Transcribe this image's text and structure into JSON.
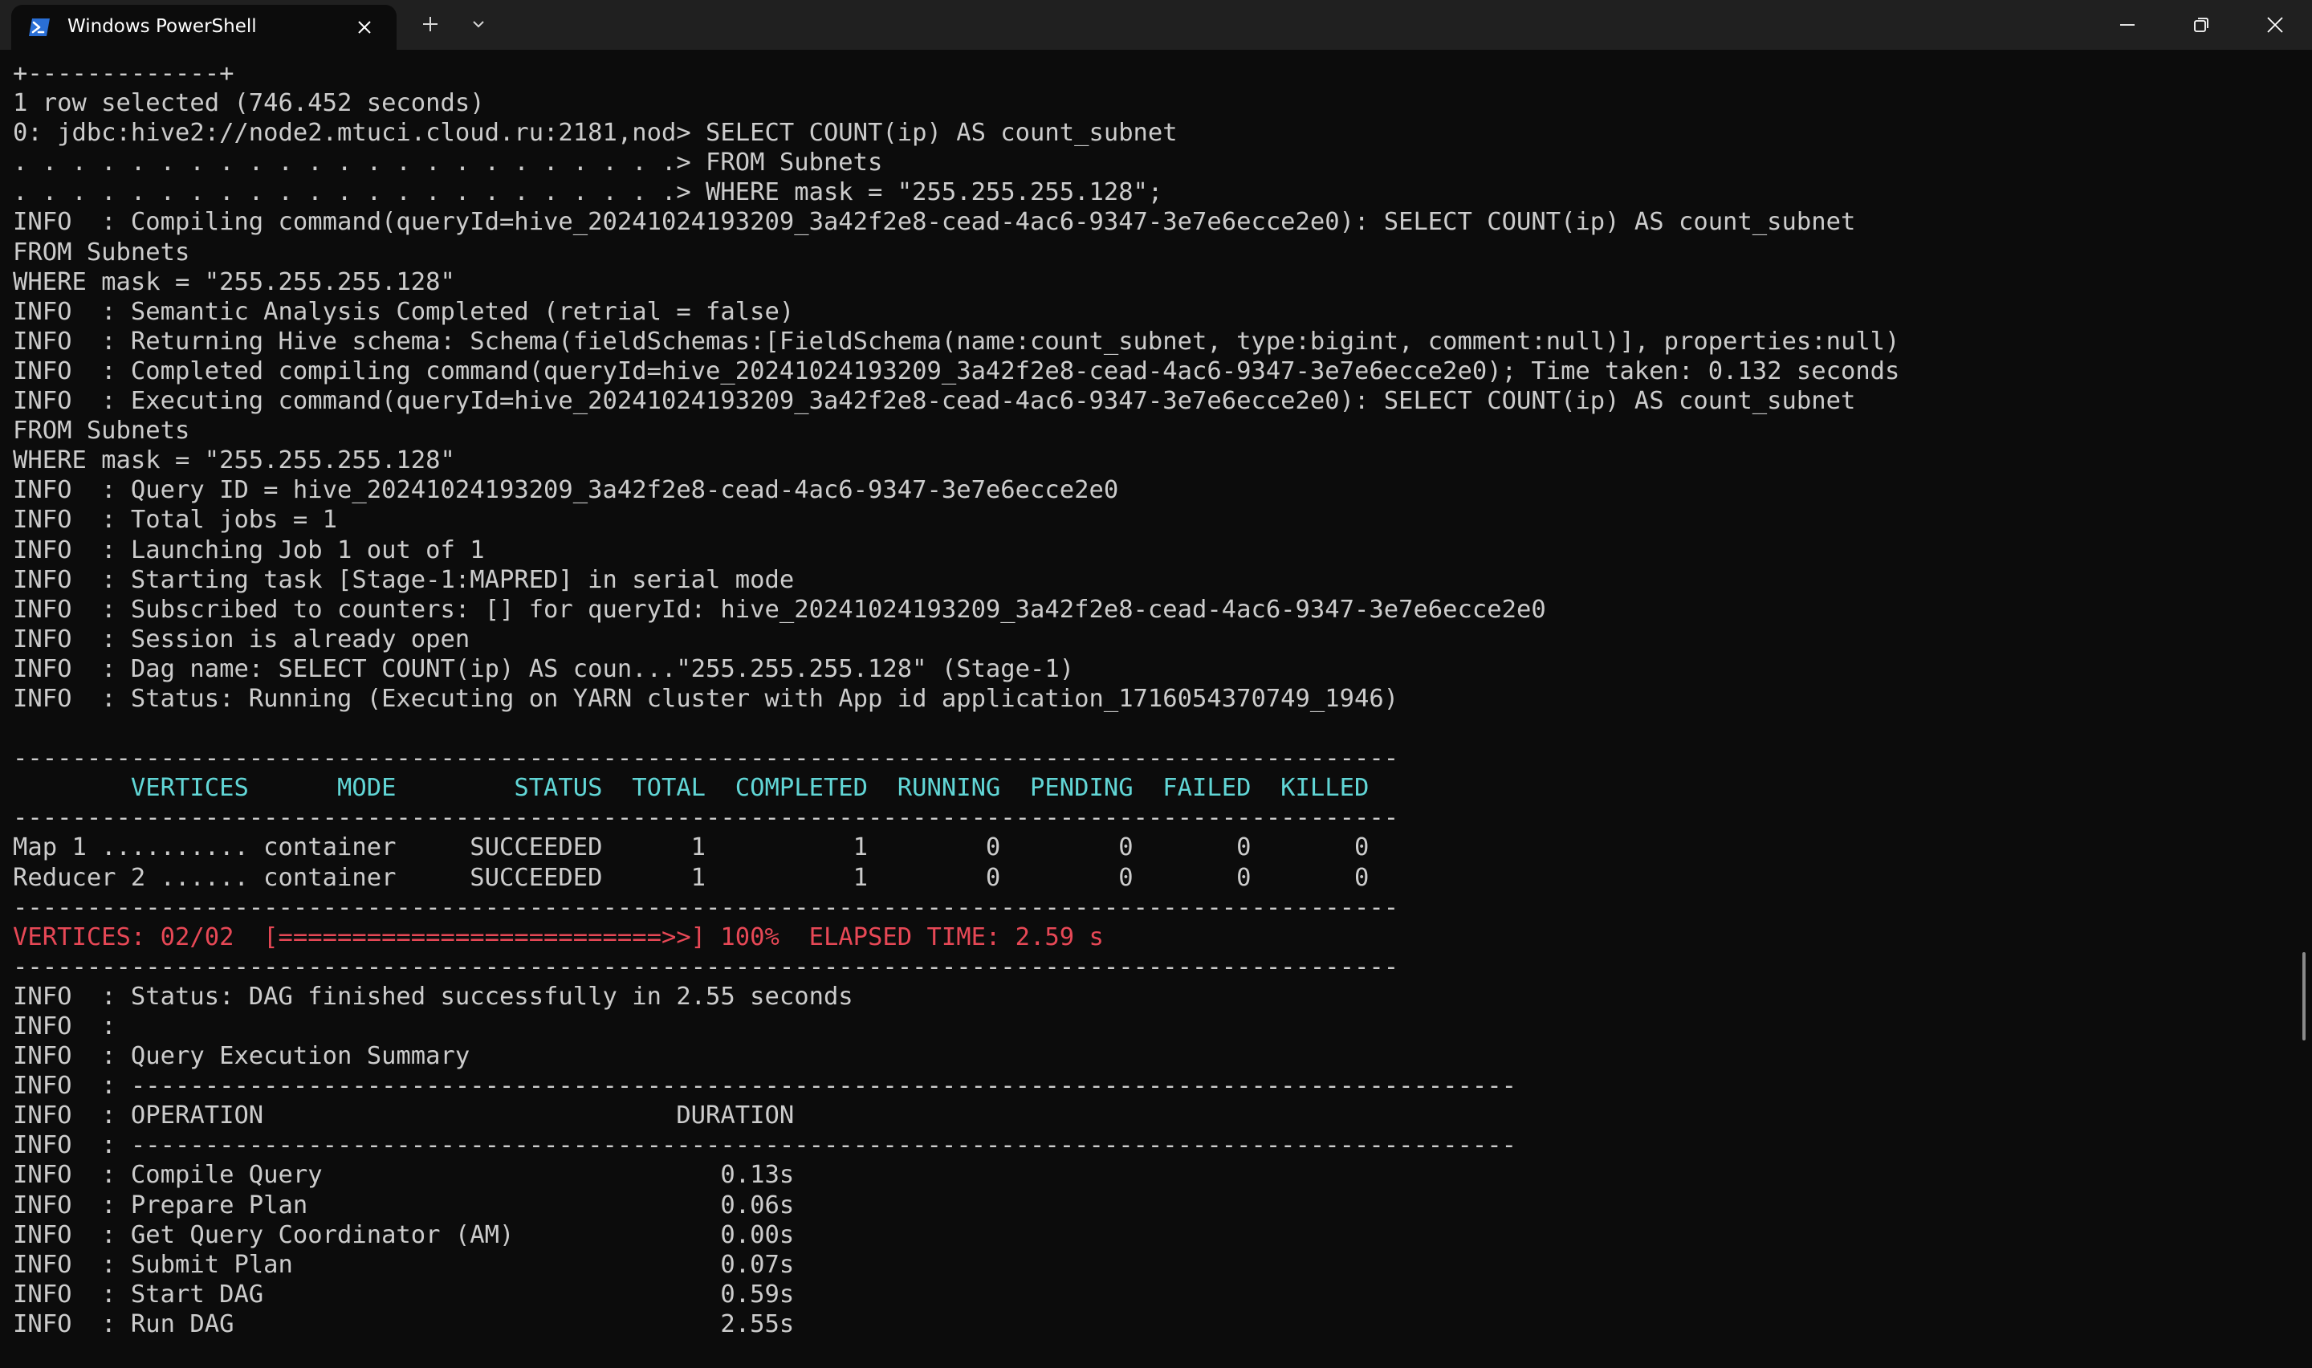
{
  "window": {
    "tab_title": "Windows PowerShell",
    "icons": {
      "tab": "powershell-icon",
      "close_tab": "close-icon",
      "new_tab": "plus-icon",
      "dropdown": "chevron-down-icon",
      "minimize": "minimize-icon",
      "maximize": "restore-icon",
      "close_window": "close-icon"
    }
  },
  "colors": {
    "background": "#0c0c0c",
    "titlebar": "#202020",
    "text": "#cccccc",
    "header": "#61d6d6",
    "progress": "#e74856"
  },
  "terminal": {
    "lines": [
      {
        "text": "+-------------+",
        "style": "normal"
      },
      {
        "text": "1 row selected (746.452 seconds)",
        "style": "normal"
      },
      {
        "text": "0: jdbc:hive2://node2.mtuci.cloud.ru:2181,nod> SELECT COUNT(ip) AS count_subnet",
        "style": "normal"
      },
      {
        "text": ". . . . . . . . . . . . . . . . . . . . . . .> FROM Subnets",
        "style": "normal"
      },
      {
        "text": ". . . . . . . . . . . . . . . . . . . . . . .> WHERE mask = \"255.255.255.128\";",
        "style": "normal"
      },
      {
        "text": "INFO  : Compiling command(queryId=hive_20241024193209_3a42f2e8-cead-4ac6-9347-3e7e6ecce2e0): SELECT COUNT(ip) AS count_subnet",
        "style": "normal"
      },
      {
        "text": "FROM Subnets",
        "style": "normal"
      },
      {
        "text": "WHERE mask = \"255.255.255.128\"",
        "style": "normal"
      },
      {
        "text": "INFO  : Semantic Analysis Completed (retrial = false)",
        "style": "normal"
      },
      {
        "text": "INFO  : Returning Hive schema: Schema(fieldSchemas:[FieldSchema(name:count_subnet, type:bigint, comment:null)], properties:null)",
        "style": "normal"
      },
      {
        "text": "INFO  : Completed compiling command(queryId=hive_20241024193209_3a42f2e8-cead-4ac6-9347-3e7e6ecce2e0); Time taken: 0.132 seconds",
        "style": "normal"
      },
      {
        "text": "INFO  : Executing command(queryId=hive_20241024193209_3a42f2e8-cead-4ac6-9347-3e7e6ecce2e0): SELECT COUNT(ip) AS count_subnet",
        "style": "normal"
      },
      {
        "text": "FROM Subnets",
        "style": "normal"
      },
      {
        "text": "WHERE mask = \"255.255.255.128\"",
        "style": "normal"
      },
      {
        "text": "INFO  : Query ID = hive_20241024193209_3a42f2e8-cead-4ac6-9347-3e7e6ecce2e0",
        "style": "normal"
      },
      {
        "text": "INFO  : Total jobs = 1",
        "style": "normal"
      },
      {
        "text": "INFO  : Launching Job 1 out of 1",
        "style": "normal"
      },
      {
        "text": "INFO  : Starting task [Stage-1:MAPRED] in serial mode",
        "style": "normal"
      },
      {
        "text": "INFO  : Subscribed to counters: [] for queryId: hive_20241024193209_3a42f2e8-cead-4ac6-9347-3e7e6ecce2e0",
        "style": "normal"
      },
      {
        "text": "INFO  : Session is already open",
        "style": "normal"
      },
      {
        "text": "INFO  : Dag name: SELECT COUNT(ip) AS coun...\"255.255.255.128\" (Stage-1)",
        "style": "normal"
      },
      {
        "text": "INFO  : Status: Running (Executing on YARN cluster with App id application_1716054370749_1946)",
        "style": "normal"
      },
      {
        "text": "",
        "style": "normal"
      },
      {
        "text": "----------------------------------------------------------------------------------------------",
        "style": "normal"
      },
      {
        "text": "        VERTICES      MODE        STATUS  TOTAL  COMPLETED  RUNNING  PENDING  FAILED  KILLED",
        "style": "header"
      },
      {
        "text": "----------------------------------------------------------------------------------------------",
        "style": "normal"
      },
      {
        "text": "Map 1 .......... container     SUCCEEDED      1          1        0        0       0       0",
        "style": "normal"
      },
      {
        "text": "Reducer 2 ...... container     SUCCEEDED      1          1        0        0       0       0",
        "style": "normal"
      },
      {
        "text": "----------------------------------------------------------------------------------------------",
        "style": "normal"
      },
      {
        "text": "VERTICES: 02/02  [==========================>>] 100%  ELAPSED TIME: 2.59 s",
        "style": "progress"
      },
      {
        "text": "----------------------------------------------------------------------------------------------",
        "style": "normal"
      },
      {
        "text": "INFO  : Status: DAG finished successfully in 2.55 seconds",
        "style": "normal"
      },
      {
        "text": "INFO  :",
        "style": "normal"
      },
      {
        "text": "INFO  : Query Execution Summary",
        "style": "normal"
      },
      {
        "text": "INFO  : ----------------------------------------------------------------------------------------------",
        "style": "normal"
      },
      {
        "text": "INFO  : OPERATION                            DURATION",
        "style": "normal"
      },
      {
        "text": "INFO  : ----------------------------------------------------------------------------------------------",
        "style": "normal"
      },
      {
        "text": "INFO  : Compile Query                           0.13s",
        "style": "normal"
      },
      {
        "text": "INFO  : Prepare Plan                            0.06s",
        "style": "normal"
      },
      {
        "text": "INFO  : Get Query Coordinator (AM)              0.00s",
        "style": "normal"
      },
      {
        "text": "INFO  : Submit Plan                             0.07s",
        "style": "normal"
      },
      {
        "text": "INFO  : Start DAG                               0.59s",
        "style": "normal"
      },
      {
        "text": "INFO  : Run DAG                                 2.55s",
        "style": "normal"
      }
    ]
  }
}
